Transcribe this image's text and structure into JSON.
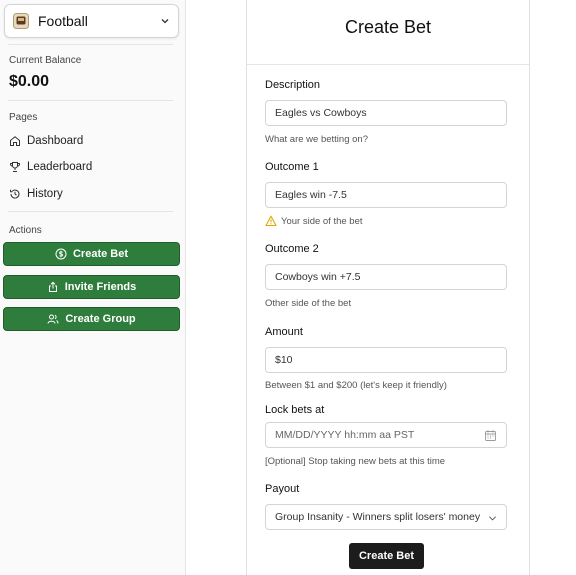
{
  "sidebar": {
    "group": {
      "name": "Football",
      "icon": "football-team-icon"
    },
    "balance_label": "Current Balance",
    "balance_value": "$0.00",
    "pages_label": "Pages",
    "pages": [
      {
        "label": "Dashboard",
        "icon": "home-icon"
      },
      {
        "label": "Leaderboard",
        "icon": "trophy-icon"
      },
      {
        "label": "History",
        "icon": "history-icon"
      }
    ],
    "actions_label": "Actions",
    "actions": [
      {
        "label": "Create Bet",
        "icon": "dollar-circle-icon"
      },
      {
        "label": "Invite Friends",
        "icon": "share-icon"
      },
      {
        "label": "Create Group",
        "icon": "users-icon"
      }
    ]
  },
  "form": {
    "title": "Create Bet",
    "description": {
      "label": "Description",
      "value": "Eagles vs Cowboys",
      "hint": "What are we betting on?"
    },
    "outcome1": {
      "label": "Outcome 1",
      "value": "Eagles win -7.5",
      "hint": "Your side of the bet",
      "hint_icon": "warning-icon"
    },
    "outcome2": {
      "label": "Outcome 2",
      "value": "Cowboys win +7.5",
      "hint": "Other side of the bet"
    },
    "amount": {
      "label": "Amount",
      "value": "$10",
      "hint": "Between $1 and $200 (let's keep it friendly)"
    },
    "lock": {
      "label": "Lock bets at",
      "placeholder": "MM/DD/YYYY hh:mm aa PST",
      "hint": "[Optional] Stop taking new bets at this time"
    },
    "payout": {
      "label": "Payout",
      "selected": "Group Insanity - Winners split losers' money"
    },
    "submit_label": "Create Bet"
  },
  "colors": {
    "action_green": "#2f7d3c",
    "submit_dark": "#1c1c1c",
    "warning": "#e0a800"
  }
}
